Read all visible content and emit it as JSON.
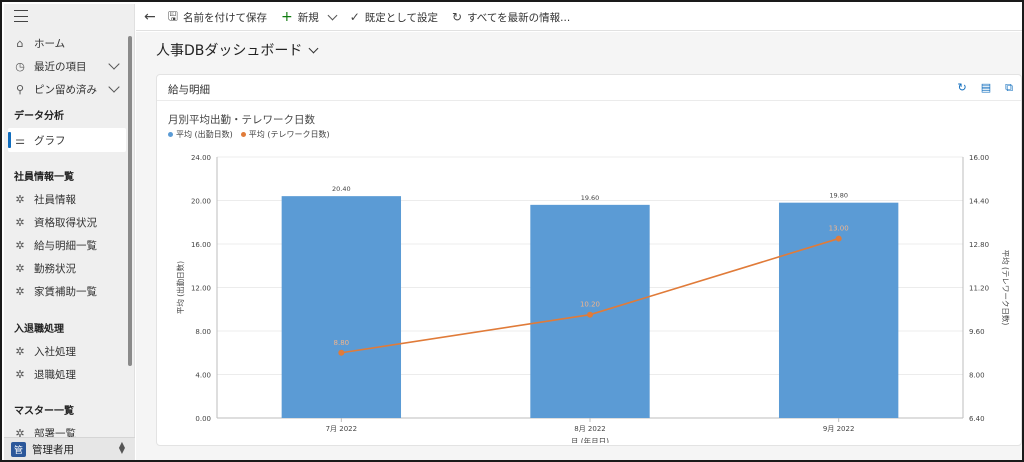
{
  "sidebar": {
    "nav": [
      {
        "icon": "home-icon",
        "glyph": "⌂",
        "label": "ホーム",
        "chevron": false
      },
      {
        "icon": "clock-icon",
        "glyph": "◷",
        "label": "最近の項目",
        "chevron": true
      },
      {
        "icon": "pin-icon",
        "glyph": "⚲",
        "label": "ピン留め済み",
        "chevron": true
      }
    ],
    "groups": [
      {
        "title": "データ分析",
        "items": [
          {
            "label": "グラフ",
            "glyph": "⚌",
            "active": true
          }
        ]
      },
      {
        "title": "社員情報一覧",
        "items": [
          {
            "label": "社員情報",
            "glyph": "✲"
          },
          {
            "label": "資格取得状況",
            "glyph": "✲"
          },
          {
            "label": "給与明細一覧",
            "glyph": "✲"
          },
          {
            "label": "勤務状況",
            "glyph": "✲"
          },
          {
            "label": "家賃補助一覧",
            "glyph": "✲"
          }
        ]
      },
      {
        "title": "入退職処理",
        "items": [
          {
            "label": "入社処理",
            "glyph": "✲"
          },
          {
            "label": "退職処理",
            "glyph": "✲"
          }
        ]
      },
      {
        "title": "マスター一覧",
        "items": [
          {
            "label": "部署一覧",
            "glyph": "✲"
          }
        ]
      }
    ],
    "footer": {
      "badge": "管",
      "label": "管理者用"
    }
  },
  "commandbar": {
    "save_as": "名前を付けて保存",
    "new": "新規",
    "set_default": "既定として設定",
    "refresh_all": "すべてを最新の情報..."
  },
  "main": {
    "dashboard_title": "人事DBダッシュボード",
    "card_title": "給与明細",
    "chart_title": "月別平均出勤・テレワーク日数"
  },
  "colors": {
    "bar": "#5b9bd5",
    "line": "#e07b39",
    "accent": "#0f6cbd"
  },
  "chart_data": {
    "type": "bar",
    "title": "月別平均出勤・テレワーク日数",
    "categories": [
      "7月 2022",
      "8月 2022",
      "9月 2022"
    ],
    "xlabel": "月 (年月日)",
    "ylabel": "平均 (出勤日数)",
    "y2label": "平均 (テレワーク日数)",
    "ylim": [
      0,
      24
    ],
    "y2lim": [
      6.4,
      16
    ],
    "yticks": [
      "0.00",
      "4.00",
      "8.00",
      "12.00",
      "16.00",
      "20.00",
      "24.00"
    ],
    "y2ticks": [
      "6.40",
      "8.00",
      "9.60",
      "11.20",
      "12.80",
      "14.40",
      "16.00"
    ],
    "legend_position": "top-left",
    "series": [
      {
        "name": "平均 (出勤日数)",
        "type": "bar",
        "axis": "left",
        "values": [
          20.4,
          19.6,
          19.8
        ],
        "labels": [
          "20.40",
          "19.60",
          "19.80"
        ]
      },
      {
        "name": "平均 (テレワーク日数)",
        "type": "line",
        "axis": "right",
        "values": [
          8.8,
          10.2,
          13.0
        ],
        "labels": [
          "8.80",
          "10.20",
          "13.00"
        ]
      }
    ]
  }
}
